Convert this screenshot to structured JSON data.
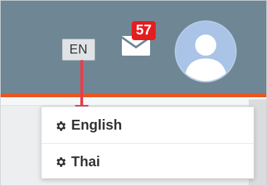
{
  "header": {
    "language_button": "EN",
    "notifications_count": "57",
    "colors": {
      "bar": "#6f8694",
      "accent_line": "#e8561f",
      "badge": "#e41e1e"
    }
  },
  "language_menu": {
    "items": [
      {
        "label": "English",
        "icon": "gear-icon"
      },
      {
        "label": "Thai",
        "icon": "gear-icon"
      }
    ]
  }
}
